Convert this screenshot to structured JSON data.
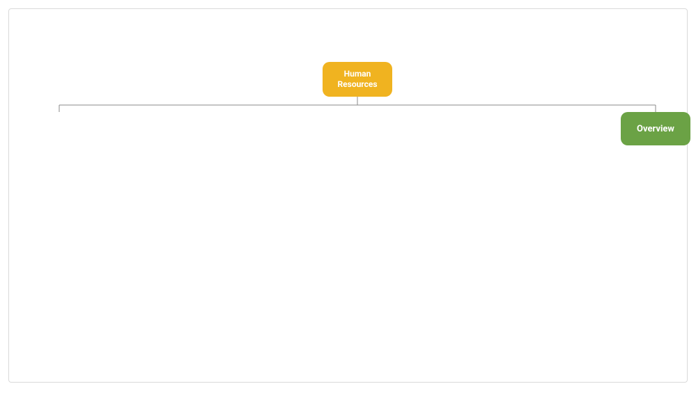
{
  "nodes": {
    "root": {
      "label": "Human Resources",
      "color": "#f0b320"
    },
    "child": {
      "label": "Overview",
      "color": "#6ba245"
    }
  }
}
